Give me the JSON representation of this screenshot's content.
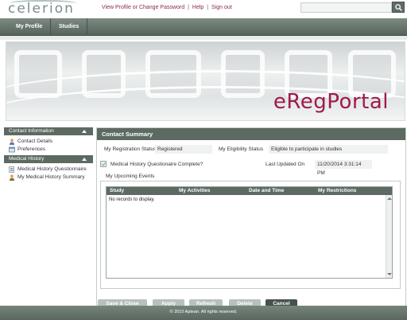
{
  "header": {
    "logo": "celerion",
    "links": [
      "View Profile or Change Password",
      "Help",
      "Sign out"
    ],
    "search": {
      "value": "",
      "placeholder": ""
    }
  },
  "nav": {
    "tabs": [
      "My Profile",
      "Studies"
    ]
  },
  "banner": {
    "brand": "eRegPortal"
  },
  "sidebar": {
    "sections": [
      {
        "title": "Contact Information",
        "items": [
          "Contact Details",
          "Preferences"
        ]
      },
      {
        "title": "Medical History",
        "items": [
          "Medical History Questionnaire",
          "My Medical History Summary"
        ]
      }
    ]
  },
  "main": {
    "title": "Contact Summary",
    "registration_label": "My Registration Status",
    "registration_value": "Registered",
    "eligibility_label": "My Eligibility Status",
    "eligibility_value": "Eligible to participate in studies",
    "mh_complete_label": "Medical History Questionaire Complete?",
    "last_updated_label": "Last Updated On",
    "last_updated_value": "11/20/2014 3:31:14 PM",
    "events_legend": "My Upcoming Events",
    "grid_headers": [
      "Study",
      "My Activities",
      "Date and Time",
      "My Restrictions"
    ],
    "empty_message": "No records to display."
  },
  "buttons": [
    "Save & Close",
    "Apply",
    "Refresh",
    "Delete",
    "Cancel"
  ],
  "footer": {
    "copyright": "© 2010 Aptean. All rights reserved."
  },
  "colors": {
    "brand": "#a0184e",
    "nav": "#5c6a62",
    "link": "#8a2a4a"
  }
}
